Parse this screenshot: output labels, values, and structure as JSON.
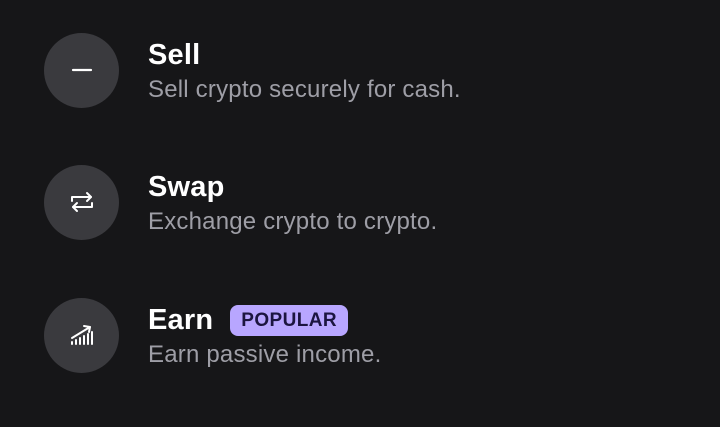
{
  "menu": {
    "items": [
      {
        "icon": "minus-icon",
        "title": "Sell",
        "subtitle": "Sell crypto securely for cash."
      },
      {
        "icon": "swap-arrows-icon",
        "title": "Swap",
        "subtitle": "Exchange crypto to crypto."
      },
      {
        "icon": "growth-chart-icon",
        "title": "Earn",
        "badge": "POPULAR",
        "subtitle": "Earn passive income."
      }
    ]
  },
  "colors": {
    "background": "#161618",
    "icon_circle": "#3a3a3e",
    "title": "#ffffff",
    "subtitle": "#9e9ea6",
    "badge_bg": "#b8a6ff",
    "badge_text": "#1c1540"
  }
}
